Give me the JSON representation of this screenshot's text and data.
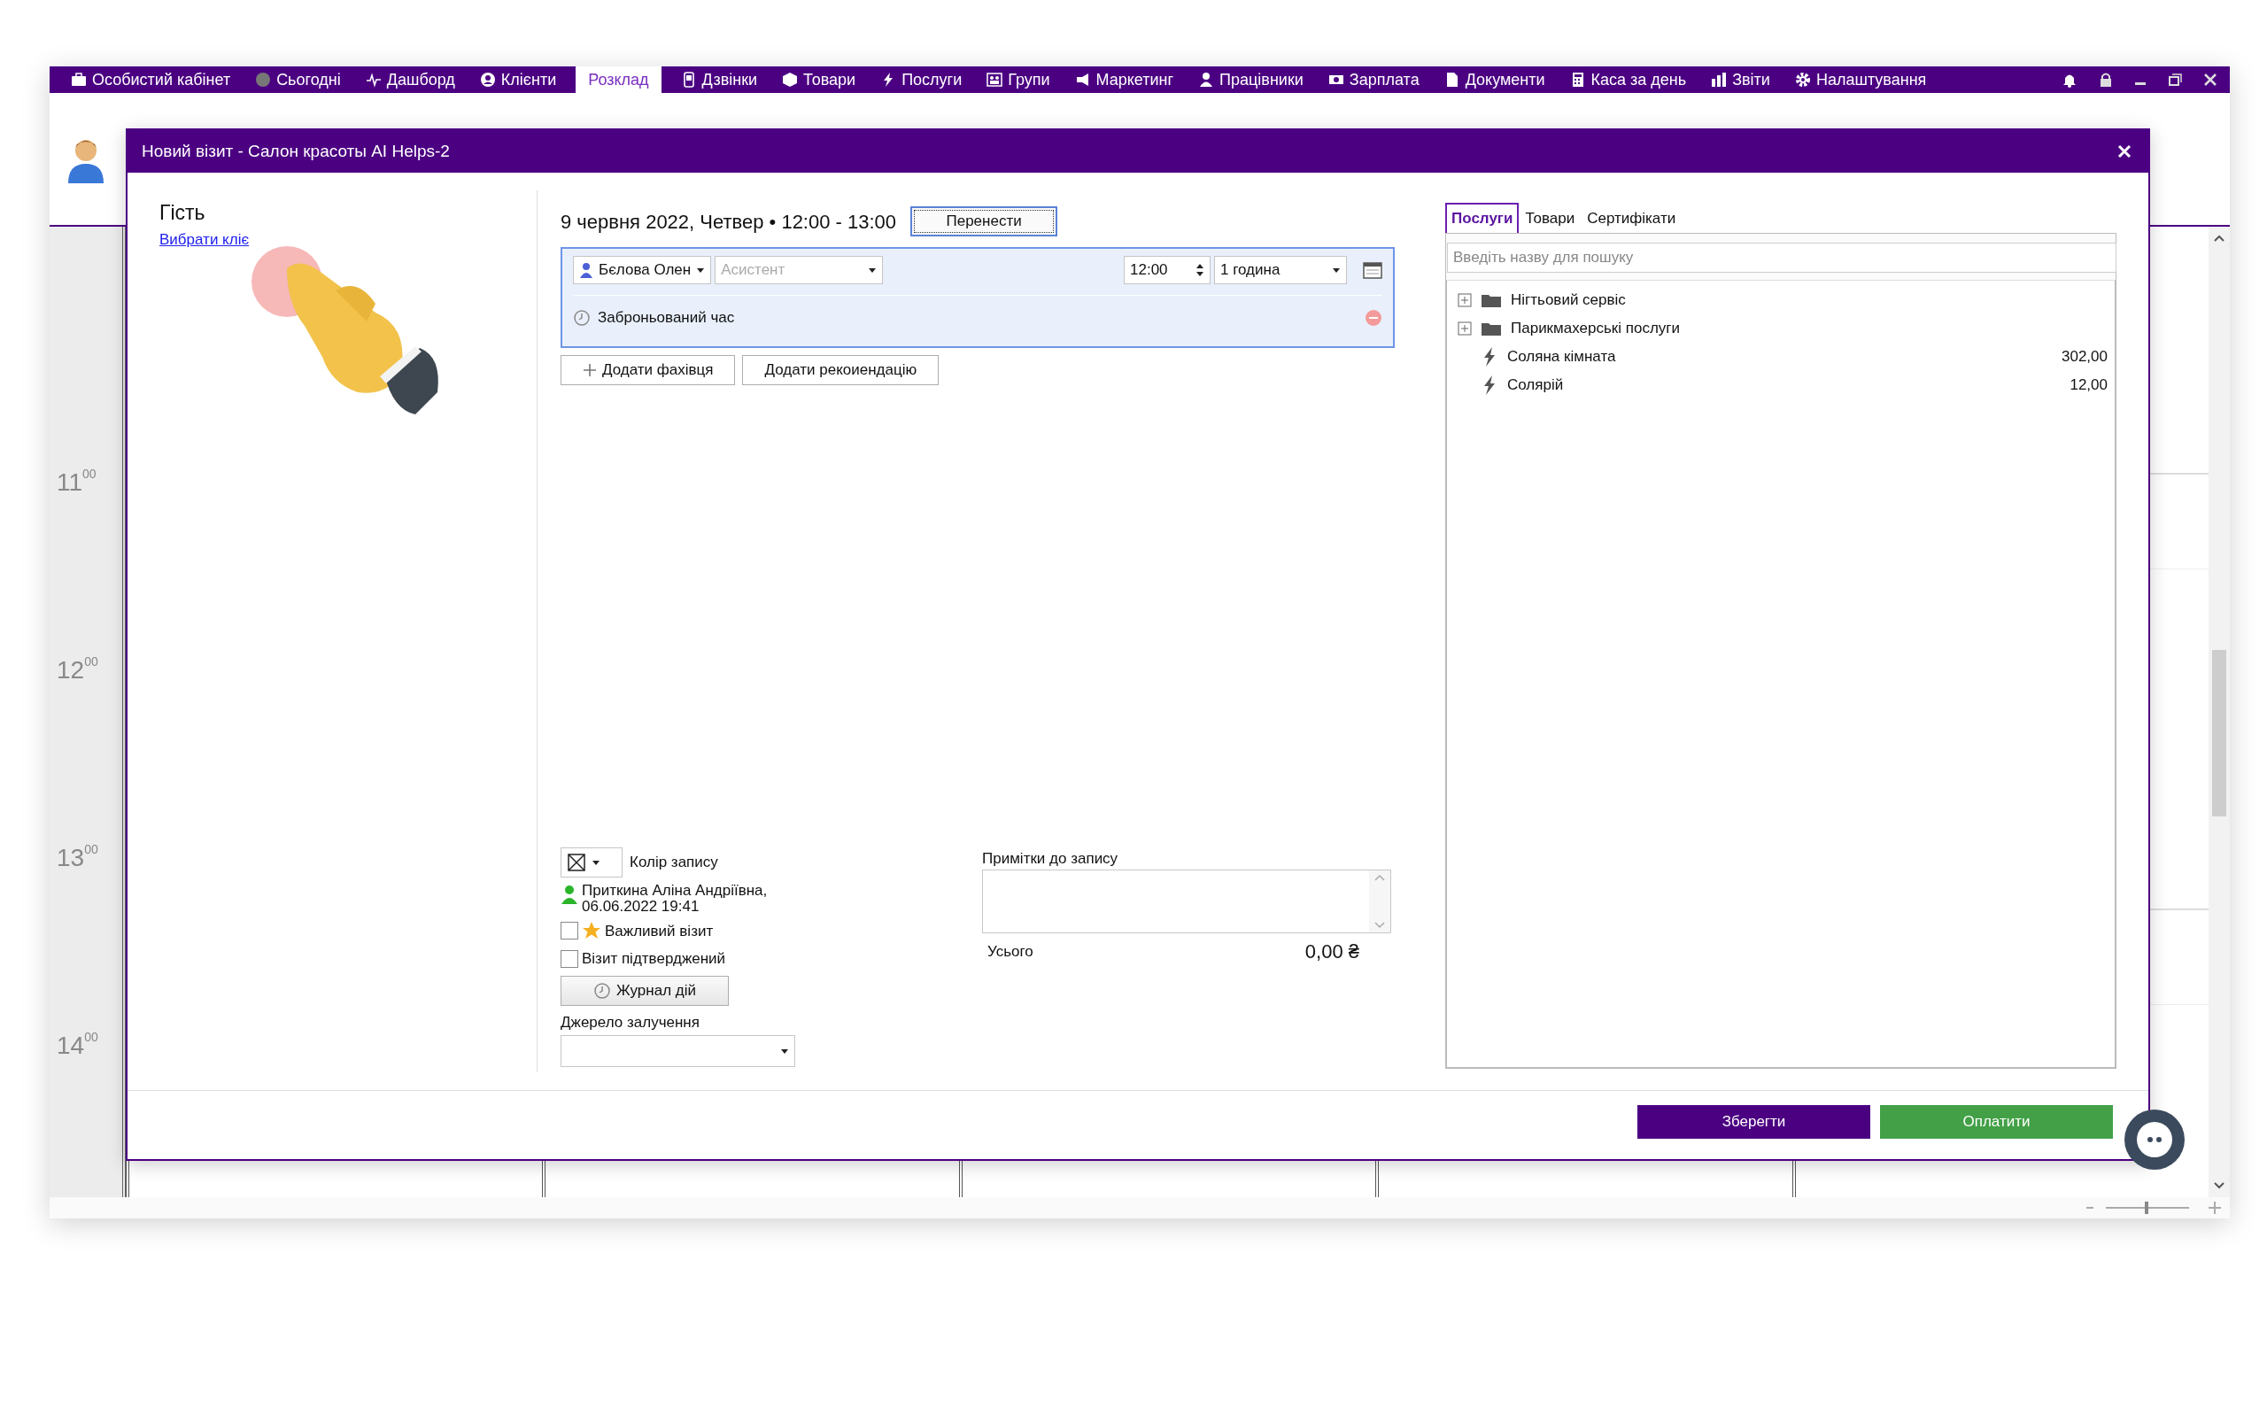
{
  "menu": [
    {
      "label": "Особистий кабінет",
      "selected": false
    },
    {
      "label": "Сьогодні",
      "selected": false
    },
    {
      "label": "Дашборд",
      "selected": false
    },
    {
      "label": "Клієнти",
      "selected": false
    },
    {
      "label": "Розклад",
      "selected": true
    },
    {
      "label": "Дзвінки",
      "selected": false
    },
    {
      "label": "Товари",
      "selected": false
    },
    {
      "label": "Послуги",
      "selected": false
    },
    {
      "label": "Групи",
      "selected": false
    },
    {
      "label": "Маркетинг",
      "selected": false
    },
    {
      "label": "Працівники",
      "selected": false
    },
    {
      "label": "Зарплата",
      "selected": false
    },
    {
      "label": "Документи",
      "selected": false
    },
    {
      "label": "Каса за день",
      "selected": false
    },
    {
      "label": "Звіти",
      "selected": false
    },
    {
      "label": "Налаштування",
      "selected": false
    }
  ],
  "zoom": {
    "level": 0.5
  },
  "calendar": {
    "hours": [
      {
        "hour": "11",
        "minutes": "00"
      },
      {
        "hour": "12",
        "minutes": "00"
      },
      {
        "hour": "13",
        "minutes": "00"
      },
      {
        "hour": "14",
        "minutes": "00"
      }
    ]
  },
  "dialog": {
    "title": "Новий візит - Салон красоты AI Helps-2",
    "guest": {
      "heading": "Гість",
      "link": "Вибрати кліє"
    },
    "datetime": "9 червня 2022, Четвер • 12:00 - 13:00",
    "reschedule_button": "Перенести",
    "service_row": {
      "specialist": "Бєлова Олен",
      "assistant": {
        "placeholder": "Асистент"
      },
      "time": "12:00",
      "duration": "1 година",
      "status": "Заброньований час"
    },
    "add_buttons": [
      "Додати фахівця",
      "Додати рекоиендацію"
    ],
    "color_label": "Колір запису",
    "created_by": "Приткина Аліна Андріївна,",
    "created_at": "06.06.2022 19:41",
    "checks": [
      {
        "kind": "star",
        "label": "Важливий візит",
        "checked": false
      },
      {
        "kind": "plain",
        "label": "Візит підтверджений",
        "checked": false
      }
    ],
    "journal_button": "Журнал дій",
    "source": {
      "label": "Джерело залучення"
    },
    "notes": {
      "label": "Примітки до запису"
    },
    "total": {
      "label": "Усього",
      "value": "0,00 ₴"
    },
    "tabs": [
      {
        "label": "Послуги",
        "selected": true
      },
      {
        "label": "Товари",
        "selected": false
      },
      {
        "label": "Сертифікати",
        "selected": false
      }
    ],
    "search": {
      "placeholder": "Введіть назву для пошуку"
    },
    "tree": [
      {
        "kind": "folder",
        "label": "Нігтьовий сервіс",
        "expanded": false
      },
      {
        "kind": "folder",
        "label": "Парикмахерські послуги",
        "expanded": false
      },
      {
        "kind": "service",
        "label": "Соляна кімната",
        "price": "302,00"
      },
      {
        "kind": "service",
        "label": "Солярій",
        "price": "12,00"
      }
    ],
    "buttons": [
      {
        "kind": "save",
        "label": "Зберегти"
      },
      {
        "kind": "pay",
        "label": "Оплатити"
      }
    ]
  }
}
